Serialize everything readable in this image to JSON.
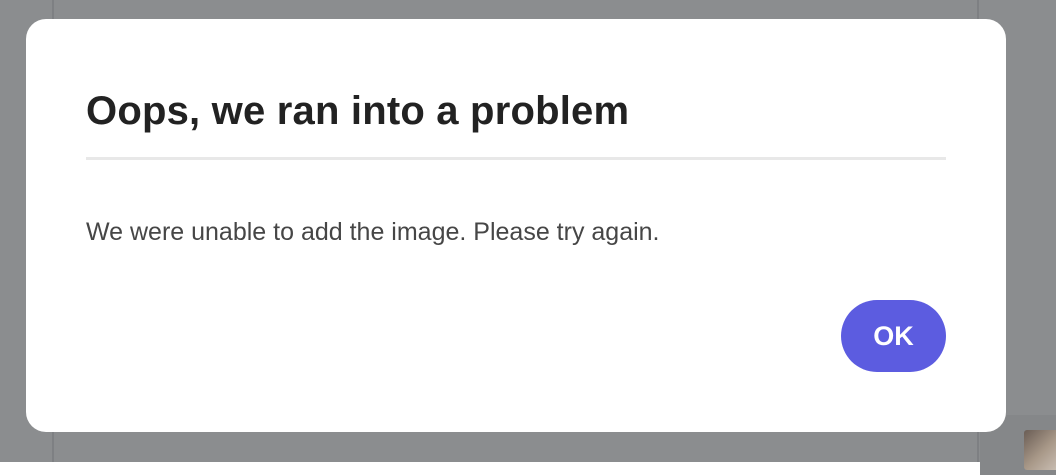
{
  "dialog": {
    "title": "Oops, we ran into a problem",
    "message": "We were unable to add the image. Please try again.",
    "ok_label": "OK"
  },
  "colors": {
    "accent": "#5c5ce0",
    "overlay": "#8b8d8f",
    "dialog_background": "#ffffff",
    "title_text": "#222222",
    "body_text": "#464646"
  }
}
